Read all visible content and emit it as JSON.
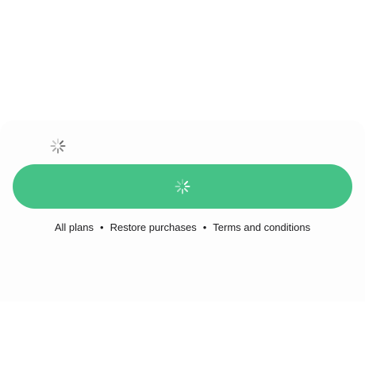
{
  "colors": {
    "page_background": "#ffffff",
    "sheet_background": "#fdfdfd",
    "primary_button": "#45c287",
    "spinner_dark": "#6b6b6b",
    "spinner_light": "#ffffff",
    "link_text": "#1c1c1e"
  },
  "loading_indicator": {
    "icon": "activity-spinner-icon"
  },
  "primary_button": {
    "state": "loading",
    "icon": "activity-spinner-icon"
  },
  "footer": {
    "links": [
      {
        "label": "All plans"
      },
      {
        "label": "Restore purchases"
      },
      {
        "label": "Terms and conditions"
      }
    ],
    "separator": "•"
  }
}
